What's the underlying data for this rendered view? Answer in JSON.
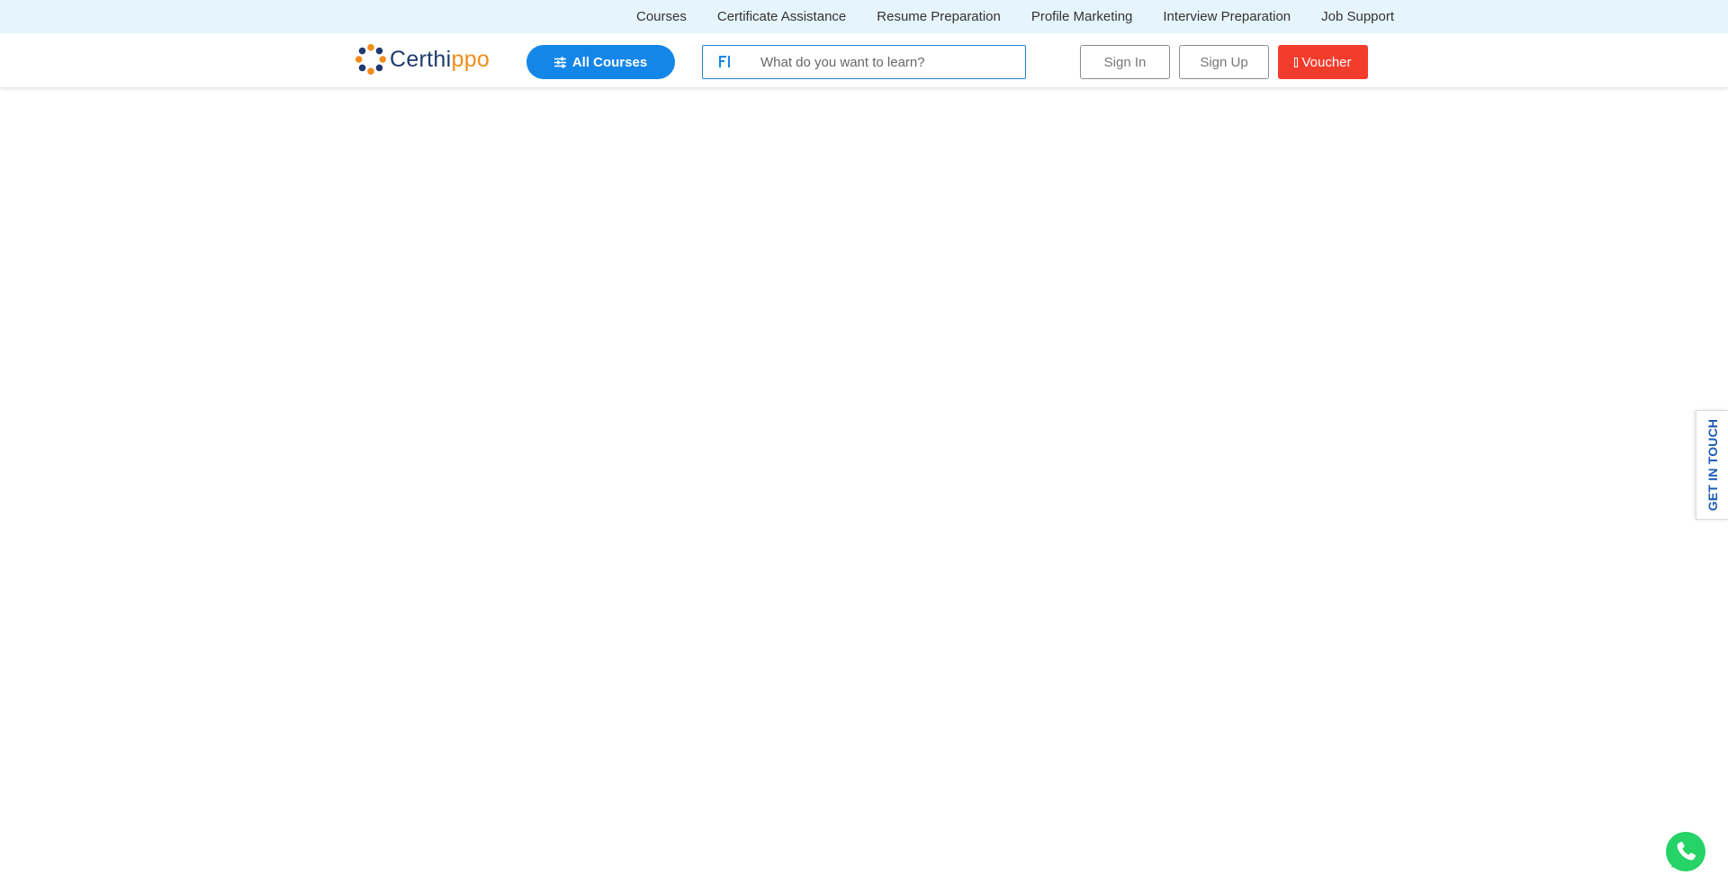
{
  "topbar": {
    "links": [
      {
        "label": "Courses"
      },
      {
        "label": "Certificate Assistance"
      },
      {
        "label": "Resume Preparation"
      },
      {
        "label": "Profile Marketing"
      },
      {
        "label": "Interview Preparation"
      },
      {
        "label": "Job Support"
      }
    ]
  },
  "header": {
    "logo": {
      "text_primary": "Certhi",
      "text_accent": "ppo",
      "icon": "flower-logo-icon"
    },
    "all_courses": {
      "label": "All Courses",
      "icon": "sliders-icon"
    },
    "search": {
      "placeholder": "What do you want to learn?",
      "value": "",
      "icon": "search-icon"
    },
    "sign_in": {
      "label": "Sign In"
    },
    "sign_up": {
      "label": "Sign Up"
    },
    "voucher": {
      "label": "Voucher",
      "icon": "voucher-icon"
    }
  },
  "side_tab": {
    "label": "GET IN TOUCH"
  },
  "whatsapp": {
    "icon": "whatsapp-icon"
  },
  "colors": {
    "topbar_bg": "#e6f5fb",
    "primary_blue": "#1486e8",
    "voucher_red": "#f43c2d",
    "whatsapp_green": "#25d366",
    "logo_navy": "#1e3a6e",
    "logo_orange": "#f28c1b"
  }
}
